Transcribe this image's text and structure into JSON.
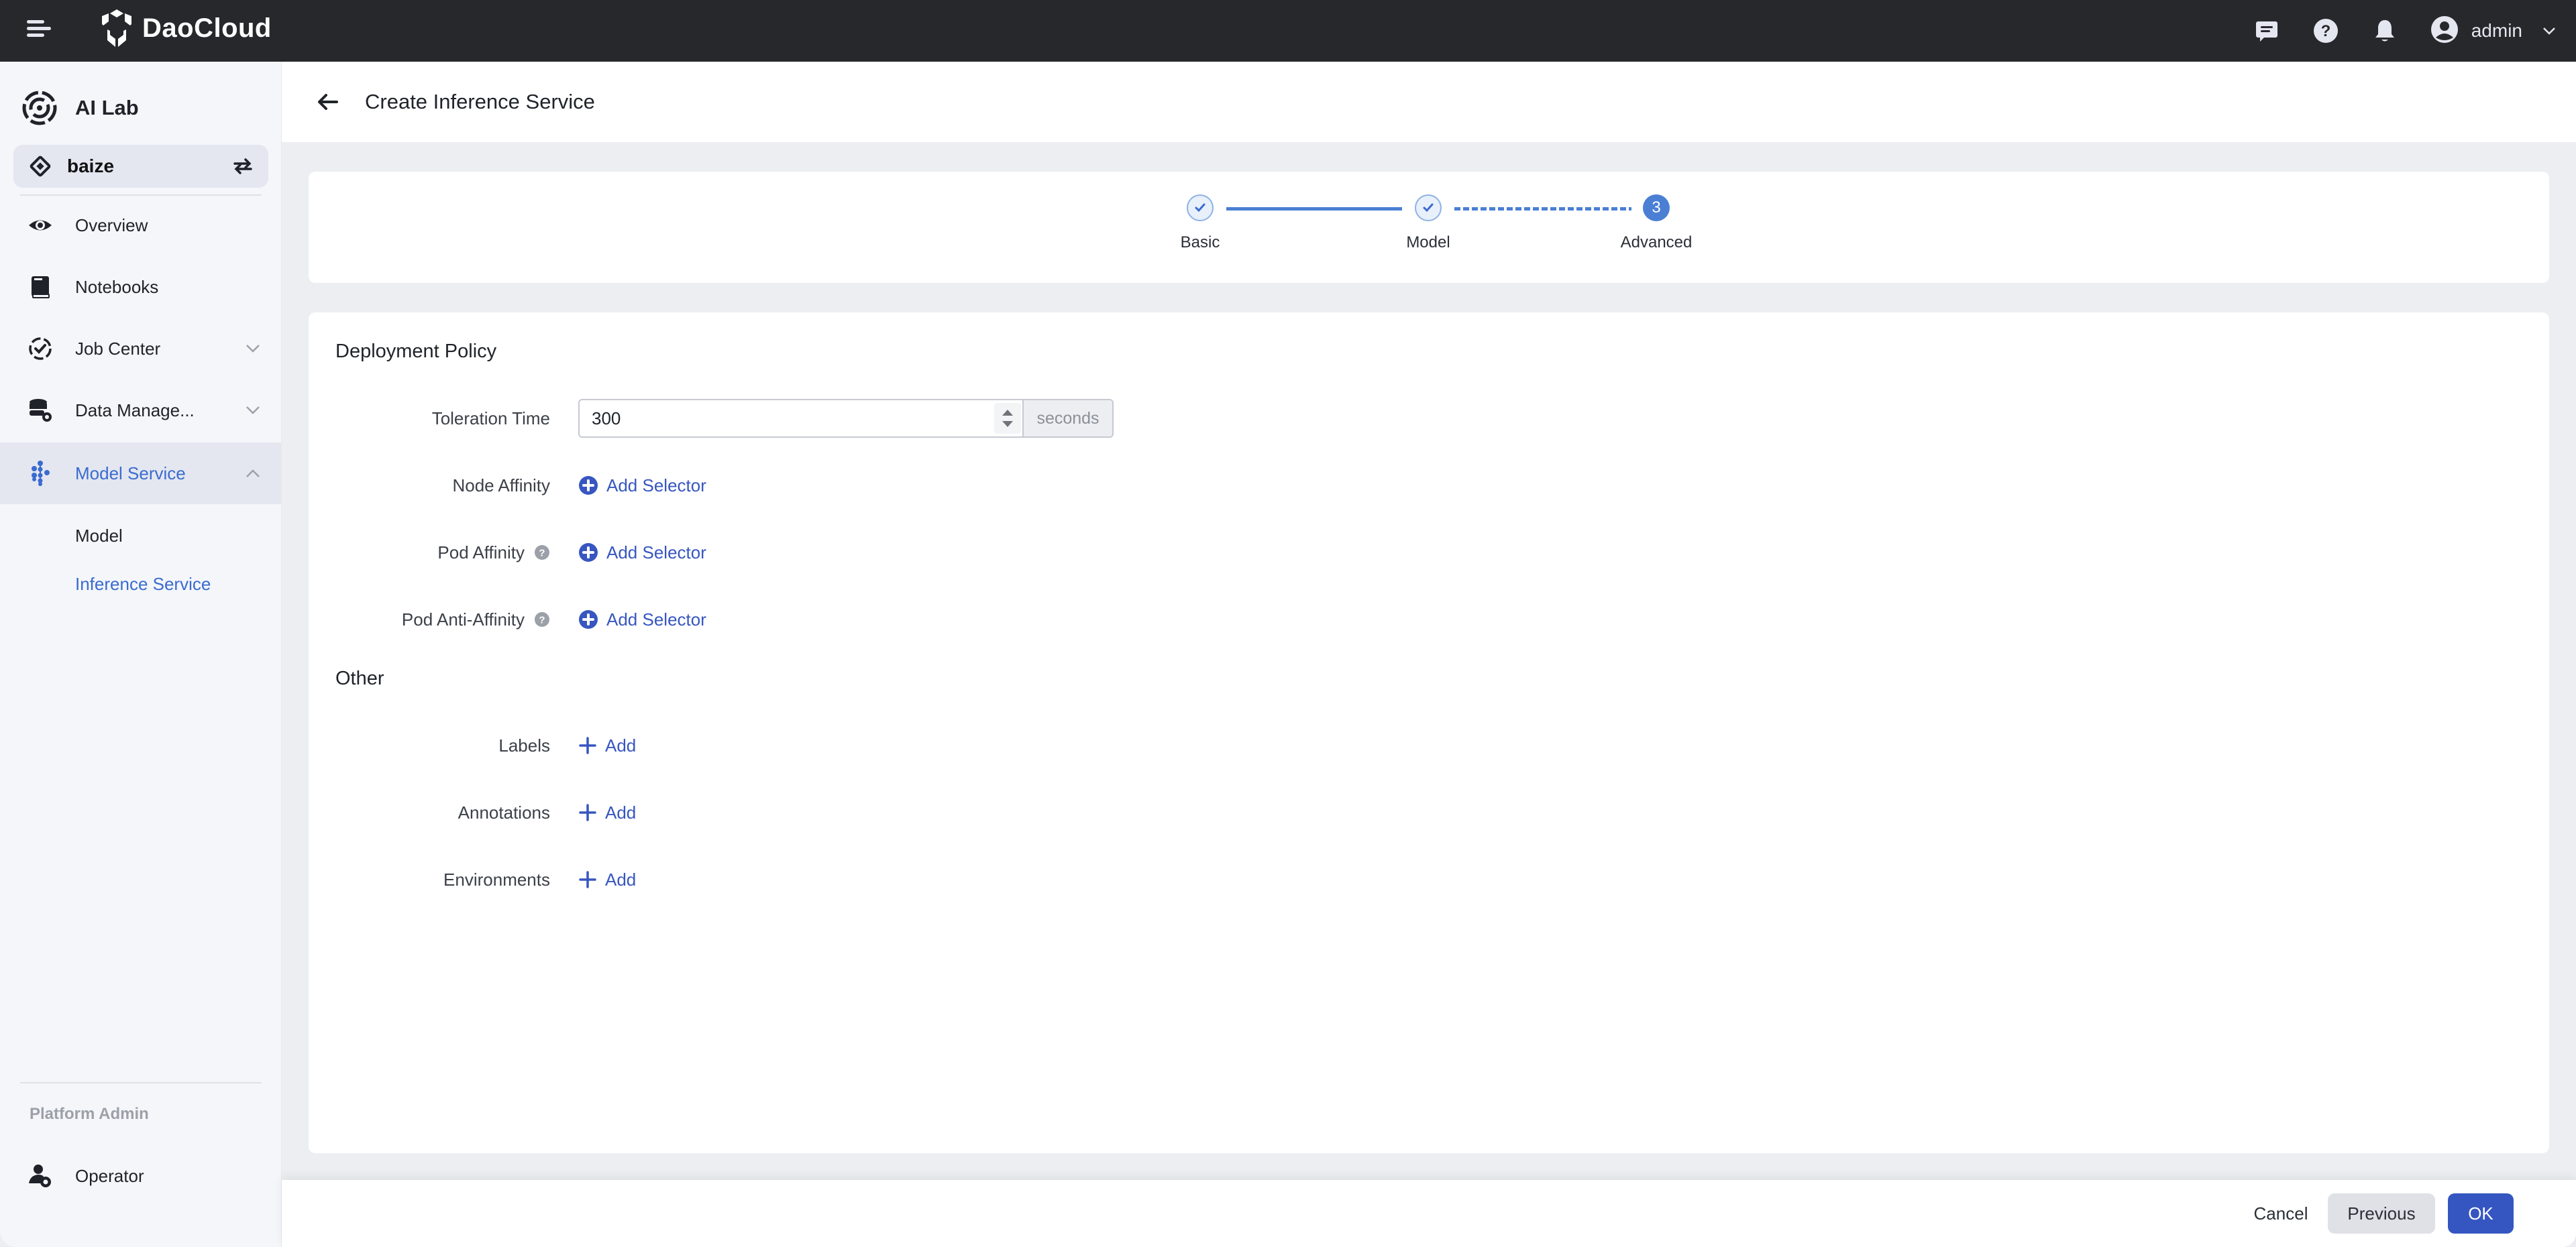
{
  "topbar": {
    "brand": "DaoCloud",
    "user": "admin",
    "icons": [
      "menu-icon",
      "message-icon",
      "help-icon",
      "bell-icon",
      "user-avatar-icon",
      "chevron-down-icon"
    ]
  },
  "sidebar": {
    "app_title": "AI Lab",
    "workspace": "baize",
    "items": [
      {
        "label": "Overview",
        "icon": "eye-icon"
      },
      {
        "label": "Notebooks",
        "icon": "book-icon"
      },
      {
        "label": "Job Center",
        "icon": "job-check-icon",
        "expandable": true
      },
      {
        "label": "Data Manage...",
        "icon": "database-gear-icon",
        "expandable": true
      },
      {
        "label": "Model Service",
        "icon": "model-nodes-icon",
        "expandable": true,
        "expanded": true,
        "active": true
      }
    ],
    "sub_items": [
      {
        "label": "Model"
      },
      {
        "label": "Inference Service",
        "active": true
      }
    ],
    "admin_section": "Platform Admin",
    "admin_items": [
      {
        "label": "Operator",
        "icon": "operator-gear-icon"
      }
    ]
  },
  "header": {
    "title": "Create Inference Service"
  },
  "stepper": {
    "steps": [
      {
        "label": "Basic",
        "status": "done"
      },
      {
        "label": "Model",
        "status": "done"
      },
      {
        "label": "Advanced",
        "status": "current",
        "number": "3"
      }
    ]
  },
  "form": {
    "deployment_policy": {
      "title": "Deployment Policy",
      "toleration_time": {
        "label": "Toleration Time",
        "value": "300",
        "suffix": "seconds"
      },
      "node_affinity": {
        "label": "Node Affinity",
        "action": "Add Selector"
      },
      "pod_affinity": {
        "label": "Pod Affinity",
        "action": "Add Selector"
      },
      "pod_anti_affinity": {
        "label": "Pod Anti-Affinity",
        "action": "Add Selector"
      }
    },
    "other": {
      "title": "Other",
      "labels": {
        "label": "Labels",
        "action": "Add"
      },
      "annotations": {
        "label": "Annotations",
        "action": "Add"
      },
      "environments": {
        "label": "Environments",
        "action": "Add"
      }
    }
  },
  "footer": {
    "cancel": "Cancel",
    "previous": "Previous",
    "ok": "OK"
  },
  "colors": {
    "accent": "#3556c1",
    "active_nav": "#3a6bd0",
    "step": "#4a7fd4",
    "topbar": "#27282c"
  }
}
